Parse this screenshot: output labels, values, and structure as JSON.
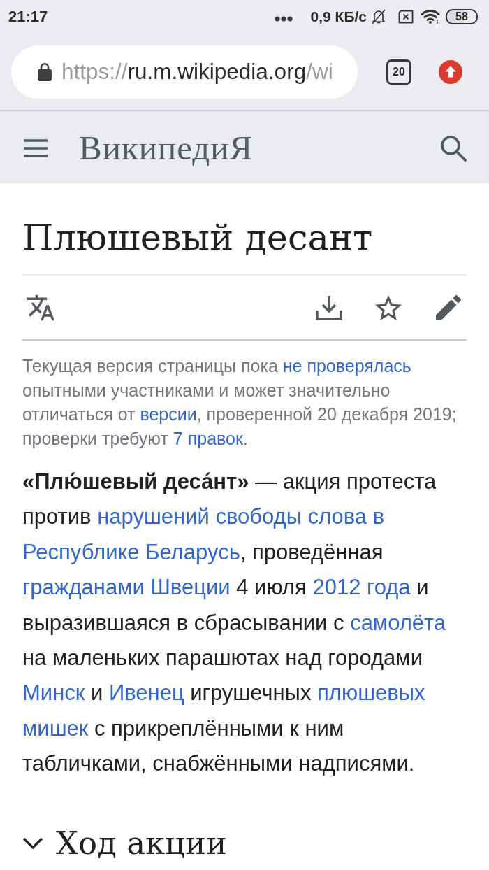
{
  "status_bar": {
    "time": "21:17",
    "network_speed": "0,9 КБ/с",
    "battery": "58"
  },
  "browser_toolbar": {
    "url": {
      "scheme": "https://",
      "host": "ru.m.wikipedia.org",
      "path": "/wi"
    },
    "tab_count": "20"
  },
  "site_header": {
    "wordmark": "ВикипедиЯ"
  },
  "article": {
    "title": "Плюшевый десант",
    "notice": [
      {
        "kind": "text",
        "text": "Текущая версия страницы пока "
      },
      {
        "kind": "link",
        "text": "не проверялась"
      },
      {
        "kind": "text",
        "text": " опытными участниками и может значительно отличаться от "
      },
      {
        "kind": "link",
        "text": "версии"
      },
      {
        "kind": "text",
        "text": ", проверенной 20 декабря 2019; проверки требуют "
      },
      {
        "kind": "link",
        "text": "7 правок"
      },
      {
        "kind": "text",
        "text": "."
      }
    ],
    "lead": [
      {
        "kind": "text",
        "text": "**«Плю́шевый деса́нт»** — акция протеста против "
      },
      {
        "kind": "split_link",
        "parts": [
          "нарушений свободы слова в",
          "Республике Беларусь"
        ]
      },
      {
        "kind": "text",
        "text": ", проведённая "
      },
      {
        "kind": "link",
        "text": "гражданами Швеции"
      },
      {
        "kind": "text",
        "text": " 4 июля "
      },
      {
        "kind": "link",
        "text": "2012 года"
      },
      {
        "kind": "text",
        "text": " и выразившаяся в сбрасывании с "
      },
      {
        "kind": "link",
        "text": "самолёта"
      },
      {
        "kind": "text",
        "text": " на маленьких парашютах над городами "
      },
      {
        "kind": "link",
        "text": "Минск"
      },
      {
        "kind": "text",
        "text": " и "
      },
      {
        "kind": "link",
        "text": "Ивенец"
      },
      {
        "kind": "text",
        "text": " игрушечных "
      },
      {
        "kind": "split_link",
        "parts": [
          "плюшевых",
          "мишек"
        ]
      },
      {
        "kind": "text",
        "text": " с прикреплёнными к ним табличками, снабжёнными надписями."
      }
    ],
    "sections": [
      {
        "title": "Ход акции",
        "expanded": false
      }
    ]
  }
}
